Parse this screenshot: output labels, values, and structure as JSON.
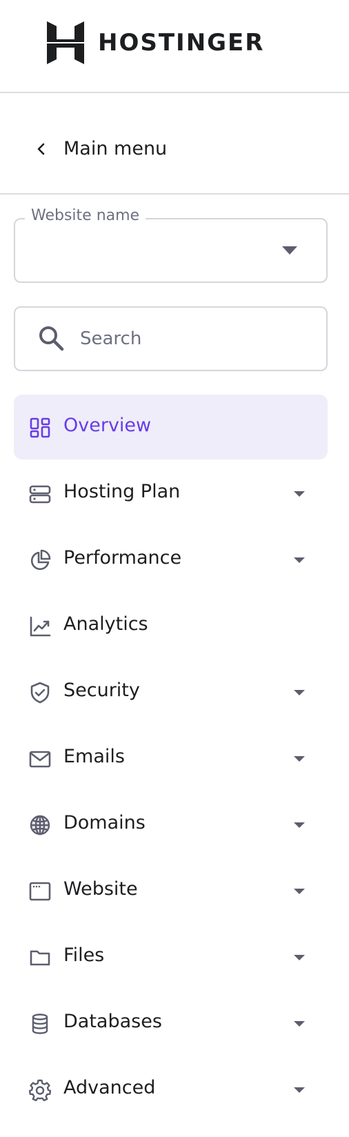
{
  "brand": {
    "name": "HOSTINGER"
  },
  "nav_back": {
    "label": "Main menu",
    "icon": "chevron-left-icon"
  },
  "website_select": {
    "label": "Website name",
    "value": ""
  },
  "search": {
    "placeholder": "Search",
    "value": ""
  },
  "colors": {
    "active_bg": "#efedf9",
    "accent": "#673de6",
    "text": "#1d1e20",
    "icon": "#5c5e6e"
  },
  "menu": {
    "items": [
      {
        "label": "Overview",
        "icon": "dashboard-icon",
        "active": true,
        "expandable": false
      },
      {
        "label": "Hosting Plan",
        "icon": "server-icon",
        "expandable": true
      },
      {
        "label": "Performance",
        "icon": "pie-chart-icon",
        "expandable": true
      },
      {
        "label": "Analytics",
        "icon": "trend-chart-icon",
        "expandable": false
      },
      {
        "label": "Security",
        "icon": "shield-icon",
        "expandable": true
      },
      {
        "label": "Emails",
        "icon": "mail-icon",
        "expandable": true
      },
      {
        "label": "Domains",
        "icon": "globe-icon",
        "expandable": true
      },
      {
        "label": "Website",
        "icon": "browser-window-icon",
        "expandable": true
      },
      {
        "label": "Files",
        "icon": "folder-icon",
        "expandable": true
      },
      {
        "label": "Databases",
        "icon": "database-icon",
        "expandable": true
      },
      {
        "label": "Advanced",
        "icon": "gear-icon",
        "expandable": true
      }
    ]
  }
}
